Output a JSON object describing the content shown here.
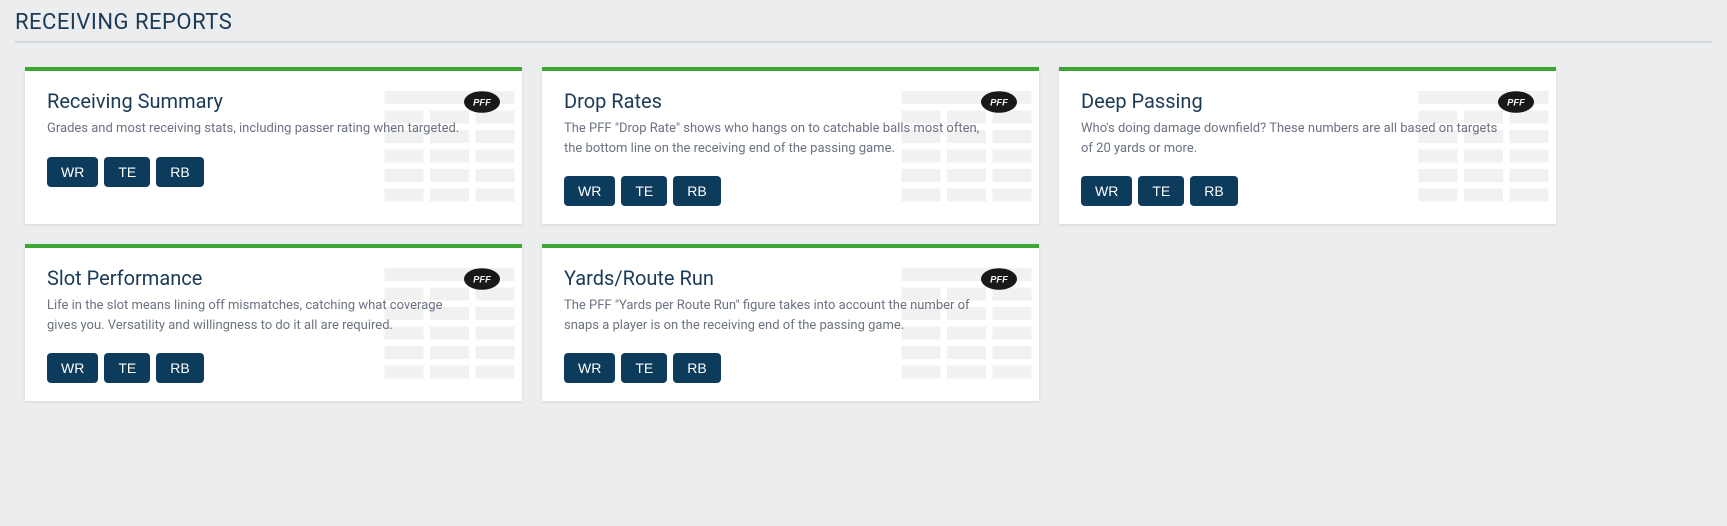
{
  "section": {
    "title": "RECEIVING REPORTS"
  },
  "cards": [
    {
      "title": "Receiving Summary",
      "description": "Grades and most receiving stats, including passer rating when targeted.",
      "buttons": [
        "WR",
        "TE",
        "RB"
      ]
    },
    {
      "title": "Drop Rates",
      "description": "The PFF \"Drop Rate\" shows who hangs on to catchable balls most often, the bottom line on the receiving end of the passing game.",
      "buttons": [
        "WR",
        "TE",
        "RB"
      ]
    },
    {
      "title": "Deep Passing",
      "description": "Who's doing damage downfield? These numbers are all based on targets of 20 yards or more.",
      "buttons": [
        "WR",
        "TE",
        "RB"
      ]
    },
    {
      "title": "Slot Performance",
      "description": "Life in the slot means lining off mismatches, catching what coverage gives you. Versatility and willingness to do it all are required.",
      "buttons": [
        "WR",
        "TE",
        "RB"
      ]
    },
    {
      "title": "Yards/Route Run",
      "description": "The PFF \"Yards per Route Run\" figure takes into account the number of snaps a player is on the receiving end of the passing game.",
      "buttons": [
        "WR",
        "TE",
        "RB"
      ]
    }
  ]
}
